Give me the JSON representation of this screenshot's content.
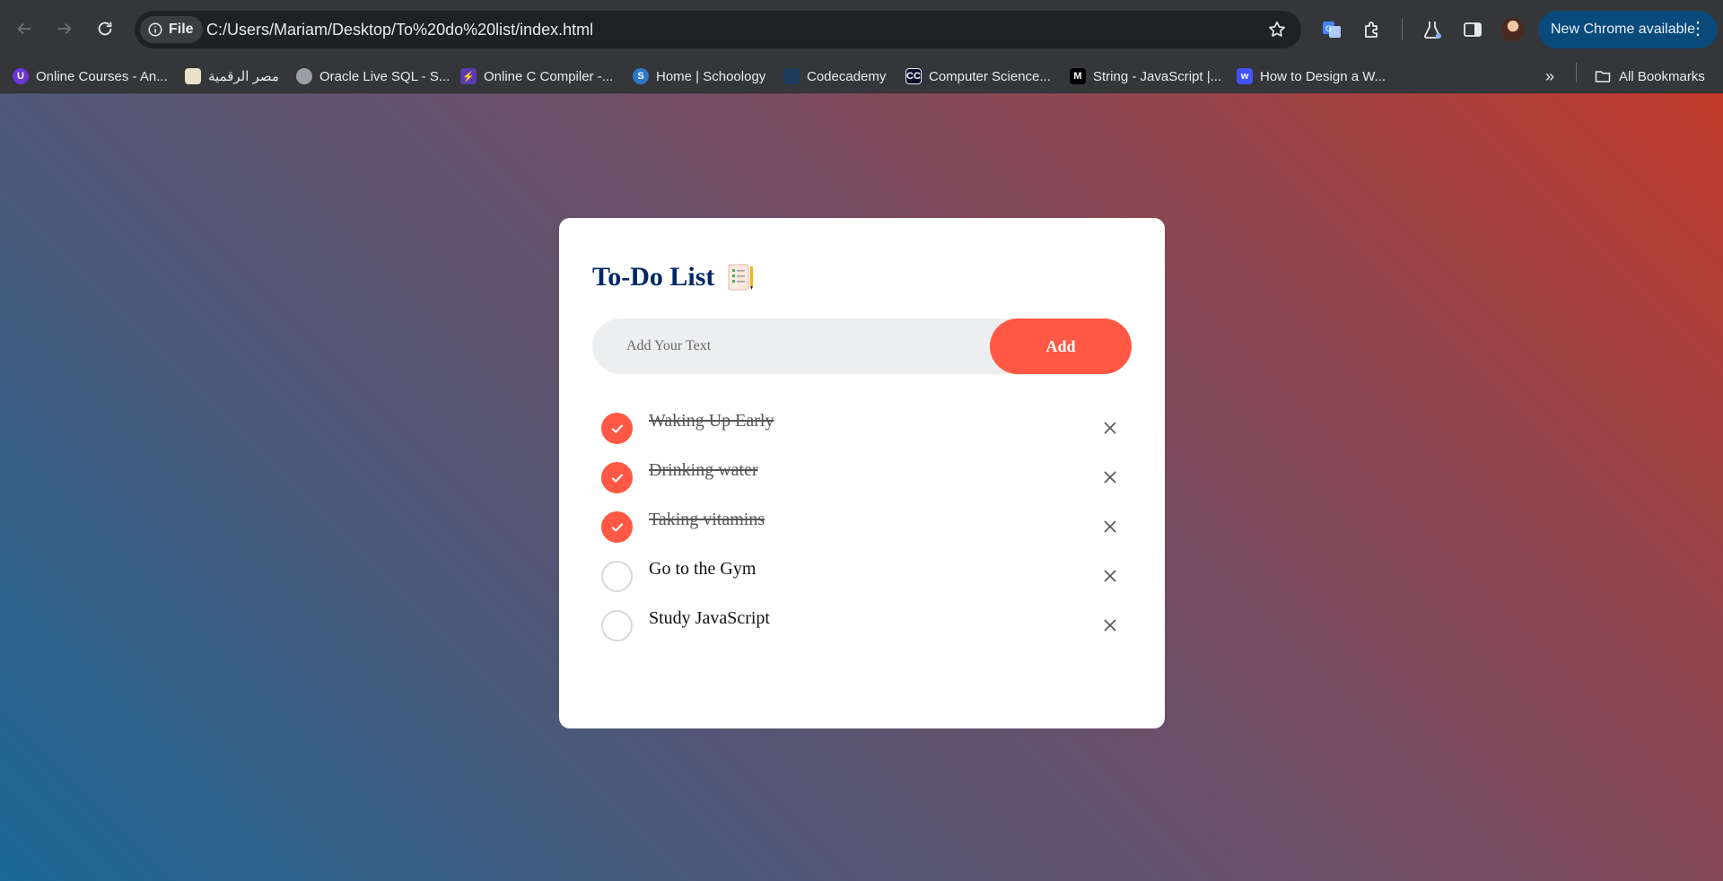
{
  "browser": {
    "file_chip_label": "File",
    "url": "C:/Users/Mariam/Desktop/To%20do%20list/index.html",
    "update_button_label": "New Chrome available",
    "bookmarks": [
      {
        "label": "Online Courses - An...",
        "icon": "udemy-icon",
        "color": "#6a35d5"
      },
      {
        "label": "مصر الرقمية",
        "icon": "digital-egypt-icon",
        "color": "#e8e0c8"
      },
      {
        "label": "Oracle Live SQL - S...",
        "icon": "globe-icon",
        "color": "#9aa0a6"
      },
      {
        "label": "Online C Compiler -...",
        "icon": "lightning-icon",
        "color": "#5b3bb0"
      },
      {
        "label": "Home | Schoology",
        "icon": "schoology-icon",
        "color": "#2e79c7"
      },
      {
        "label": "Codecademy",
        "icon": "codecademy-icon",
        "color": "#1f3a5f"
      },
      {
        "label": "Computer Science...",
        "icon": "cs-icon",
        "color": "#0b0c2a"
      },
      {
        "label": "String - JavaScript |...",
        "icon": "mdn-icon",
        "color": "#000000"
      },
      {
        "label": "How to Design a W...",
        "icon": "webflow-icon",
        "color": "#4353ff"
      }
    ],
    "all_bookmarks_label": "All Bookmarks"
  },
  "app": {
    "title": "To-Do List",
    "input_placeholder": "Add Your Text",
    "input_value": "",
    "add_button_label": "Add",
    "tasks": [
      {
        "text": "Waking Up Early",
        "done": true
      },
      {
        "text": "Drinking water",
        "done": true
      },
      {
        "text": "Taking vitamins",
        "done": true
      },
      {
        "text": "Go to the Gym",
        "done": false
      },
      {
        "text": "Study JavaScript",
        "done": false
      }
    ]
  },
  "colors": {
    "accent": "#ff5945",
    "title": "#002765",
    "gradient_start": "#1b6896",
    "gradient_end": "#c0392b"
  }
}
